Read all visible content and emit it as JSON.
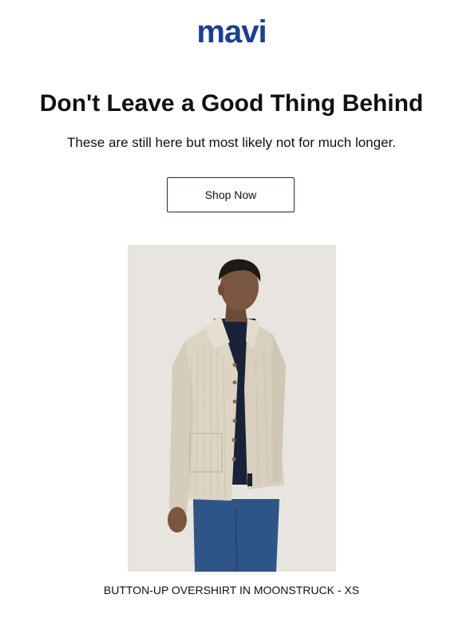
{
  "brand": {
    "logo_text": "mavi",
    "logo_color": "#1d3f8f"
  },
  "hero": {
    "headline": "Don't Leave a Good Thing Behind",
    "subtext": "These are still here but most likely not for much longer."
  },
  "cta": {
    "label": "Shop Now"
  },
  "product": {
    "image_subject": "man wearing cream corduroy button-up overshirt over navy shirt and blue jeans",
    "caption": "BUTTON-UP OVERSHIRT IN MOONSTRUCK - XS"
  },
  "colors": {
    "text": "#111111",
    "button_border": "#1d2b4a",
    "image_background": "#e8e5e1",
    "jacket": "#ddd4c4",
    "inner_shirt": "#1a2238",
    "jeans": "#2f5488"
  }
}
